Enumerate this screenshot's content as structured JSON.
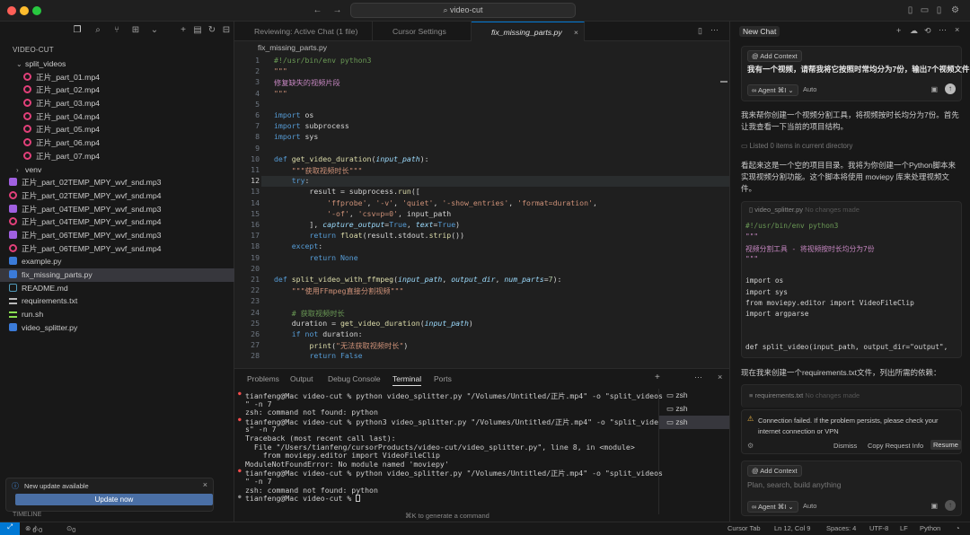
{
  "window": {
    "title": "video-cut"
  },
  "explorer": {
    "title": "VIDEO-CUT",
    "timeline": "TIMELINE"
  },
  "tree": [
    {
      "label": "split_videos",
      "kind": "folder-open",
      "indent": 1
    },
    {
      "label": "正片_part_01.mp4",
      "kind": "mp4",
      "indent": 2
    },
    {
      "label": "正片_part_02.mp4",
      "kind": "mp4",
      "indent": 2
    },
    {
      "label": "正片_part_03.mp4",
      "kind": "mp4",
      "indent": 2
    },
    {
      "label": "正片_part_04.mp4",
      "kind": "mp4",
      "indent": 2
    },
    {
      "label": "正片_part_05.mp4",
      "kind": "mp4",
      "indent": 2
    },
    {
      "label": "正片_part_06.mp4",
      "kind": "mp4",
      "indent": 2
    },
    {
      "label": "正片_part_07.mp4",
      "kind": "mp4",
      "indent": 2
    },
    {
      "label": "venv",
      "kind": "folder",
      "indent": 1
    },
    {
      "label": "正片_part_02TEMP_MPY_wvf_snd.mp3",
      "kind": "mp3",
      "indent": 0
    },
    {
      "label": "正片_part_02TEMP_MPY_wvf_snd.mp4",
      "kind": "mp4",
      "indent": 0
    },
    {
      "label": "正片_part_04TEMP_MPY_wvf_snd.mp3",
      "kind": "mp3",
      "indent": 0
    },
    {
      "label": "正片_part_04TEMP_MPY_wvf_snd.mp4",
      "kind": "mp4",
      "indent": 0
    },
    {
      "label": "正片_part_06TEMP_MPY_wvf_snd.mp3",
      "kind": "mp3",
      "indent": 0
    },
    {
      "label": "正片_part_06TEMP_MPY_wvf_snd.mp4",
      "kind": "mp4",
      "indent": 0
    },
    {
      "label": "example.py",
      "kind": "py",
      "indent": 0
    },
    {
      "label": "fix_missing_parts.py",
      "kind": "py",
      "indent": 0,
      "selected": true
    },
    {
      "label": "README.md",
      "kind": "md",
      "indent": 0
    },
    {
      "label": "requirements.txt",
      "kind": "txt",
      "indent": 0
    },
    {
      "label": "run.sh",
      "kind": "sh",
      "indent": 0
    },
    {
      "label": "video_splitter.py",
      "kind": "py",
      "indent": 0
    }
  ],
  "update": {
    "title": "New update available",
    "button": "Update now"
  },
  "tabs": [
    {
      "label": "Reviewing: Active Chat (1 file)"
    },
    {
      "label": "Cursor Settings"
    },
    {
      "label": "fix_missing_parts.py",
      "active": true
    }
  ],
  "breadcrumb": "fix_missing_parts.py",
  "code": {
    "line_numbers": [
      "1",
      "2",
      "3",
      "4",
      "5",
      "6",
      "7",
      "8",
      "9",
      "10",
      "11",
      "12",
      "13",
      "14",
      "15",
      "16",
      "17",
      "18",
      "19",
      "20",
      "21",
      "22",
      "23",
      "24",
      "25",
      "26",
      "27",
      "28"
    ],
    "lines": [
      "#!/usr/bin/env python3",
      "\"\"\"",
      "修复缺失的视频片段",
      "\"\"\"",
      "",
      "import os",
      "import subprocess",
      "import sys",
      "",
      "def get_video_duration(input_path):",
      "    \"\"\"获取视频时长\"\"\"",
      "    try:",
      "        result = subprocess.run([",
      "            'ffprobe', '-v', 'quiet', '-show_entries', 'format=duration',",
      "            '-of', 'csv=p=0', input_path",
      "        ], capture_output=True, text=True)",
      "        return float(result.stdout.strip())",
      "    except:",
      "        return None",
      "",
      "def split_video_with_ffmpeg(input_path, output_dir, num_parts=7):",
      "    \"\"\"使用FFmpeg直接分割视频\"\"\"",
      "",
      "    # 获取视频时长",
      "    duration = get_video_duration(input_path)",
      "    if not duration:",
      "        print(\"无法获取视频时长\")",
      "        return False"
    ]
  },
  "panel": {
    "tabs": [
      "Problems",
      "Output",
      "Debug Console",
      "Terminal",
      "Ports"
    ],
    "active_tab": "Terminal",
    "terminal": [
      "tianfeng@Mac video-cut % python video_splitter.py \"/Volumes/Untitled/正片.mp4\" -o \"split_videos",
      "\" -n 7",
      "zsh: command not found: python",
      "tianfeng@Mac video-cut % python3 video_splitter.py \"/Volumes/Untitled/正片.mp4\" -o \"split_video",
      "s\" -n 7",
      "Traceback (most recent call last):",
      "  File \"/Users/tianfeng/cursorProducts/video-cut/video_splitter.py\", line 8, in <module>",
      "    from moviepy.editor import VideoFileClip",
      "ModuleNotFoundError: No module named 'moviepy'",
      "tianfeng@Mac video-cut % python video_splitter.py \"/Volumes/Untitled/正片.mp4\" -o \"split_videos",
      "\" -n 7",
      "zsh: command not found: python",
      "tianfeng@Mac video-cut % "
    ],
    "terminals": [
      "zsh",
      "zsh",
      "zsh"
    ],
    "gen_cmd": "⌘K to generate a command"
  },
  "chat": {
    "title": "New Chat",
    "add_context": "Add Context",
    "user_msg": "我有一个视频，请帮我将它按照时常均分为7份，输出7个视频文件",
    "agent_label": "Agent ⌘I",
    "auto_label": "Auto",
    "p1": "我来帮你创建一个视频分割工具，将视频按时长均分为7份。首先让我查看一下当前的项目结构。",
    "listed": "Listed 0 items in current directory",
    "p2": "看起来这是一个空的项目目录。我将为你创建一个Python脚本来实现视频分割功能。这个脚本将使用 moviepy 库来处理视频文件。",
    "file1": "video_splitter.py",
    "no_changes": "No changes made",
    "snippet": [
      "#!/usr/bin/env python3",
      "\"\"\"",
      "视频分割工具 - 将视频按时长均分为7份",
      "\"\"\"",
      "",
      "import os",
      "import sys",
      "from moviepy.editor import VideoFileClip",
      "import argparse",
      "",
      "",
      "def split_video(input_path, output_dir=\"output\","
    ],
    "p3": "现在我来创建一个requirements.txt文件，列出所需的依赖：",
    "file2": "requirements.txt",
    "error": "Connection failed. If the problem persists, please check your internet connection or VPN",
    "dismiss": "Dismiss",
    "copy_req": "Copy Request Info",
    "resume": "Resume",
    "placeholder": "Plan, search, build anything"
  },
  "status": {
    "errors": "0",
    "warnings": "0",
    "ports": "0",
    "right": [
      "Cursor Tab",
      "Ln 12, Col 9",
      "Spaces: 4",
      "UTF-8",
      "LF",
      "Python"
    ]
  },
  "colors": {
    "accent": "#0078d4",
    "mp4": "#e2407a",
    "mp3": "#a060e0",
    "py": "#3b7bd8"
  }
}
